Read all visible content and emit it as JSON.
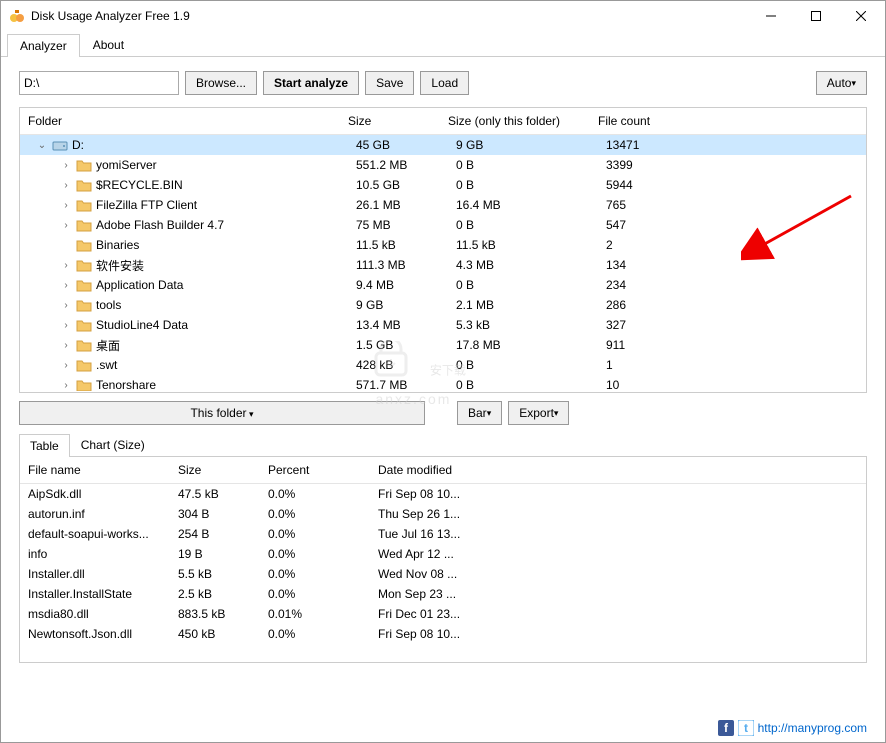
{
  "window": {
    "title": "Disk Usage Analyzer Free 1.9"
  },
  "tabs": {
    "analyzer": "Analyzer",
    "about": "About"
  },
  "toolbar": {
    "path": "D:\\",
    "browse": "Browse...",
    "start": "Start analyze",
    "save": "Save",
    "load": "Load",
    "auto": "Auto"
  },
  "tree_columns": {
    "folder": "Folder",
    "size": "Size",
    "size_only": "Size (only this folder)",
    "file_count": "File count"
  },
  "tree": [
    {
      "indent": 0,
      "expand": "⌄",
      "icon": "drive",
      "name": "D:",
      "size": "45 GB",
      "size_only": "9 GB",
      "count": "13471",
      "selected": true
    },
    {
      "indent": 1,
      "expand": "›",
      "icon": "folder",
      "name": "yomiServer",
      "size": "551.2 MB",
      "size_only": "0 B",
      "count": "3399"
    },
    {
      "indent": 1,
      "expand": "›",
      "icon": "folder",
      "name": "$RECYCLE.BIN",
      "size": "10.5 GB",
      "size_only": "0 B",
      "count": "5944"
    },
    {
      "indent": 1,
      "expand": "›",
      "icon": "folder",
      "name": "FileZilla FTP Client",
      "size": "26.1 MB",
      "size_only": "16.4 MB",
      "count": "765"
    },
    {
      "indent": 1,
      "expand": "›",
      "icon": "folder",
      "name": "Adobe Flash Builder 4.7",
      "size": "75 MB",
      "size_only": "0 B",
      "count": "547"
    },
    {
      "indent": 1,
      "expand": "",
      "icon": "folder",
      "name": "Binaries",
      "size": "11.5 kB",
      "size_only": "11.5 kB",
      "count": "2"
    },
    {
      "indent": 1,
      "expand": "›",
      "icon": "folder",
      "name": "软件安装",
      "size": "111.3 MB",
      "size_only": "4.3 MB",
      "count": "134"
    },
    {
      "indent": 1,
      "expand": "›",
      "icon": "folder",
      "name": "Application Data",
      "size": "9.4 MB",
      "size_only": "0 B",
      "count": "234"
    },
    {
      "indent": 1,
      "expand": "›",
      "icon": "folder",
      "name": "tools",
      "size": "9 GB",
      "size_only": "2.1 MB",
      "count": "286"
    },
    {
      "indent": 1,
      "expand": "›",
      "icon": "folder",
      "name": "StudioLine4 Data",
      "size": "13.4 MB",
      "size_only": "5.3 kB",
      "count": "327"
    },
    {
      "indent": 1,
      "expand": "›",
      "icon": "folder",
      "name": "桌面",
      "size": "1.5 GB",
      "size_only": "17.8 MB",
      "count": "911"
    },
    {
      "indent": 1,
      "expand": "›",
      "icon": "folder",
      "name": ".swt",
      "size": "428 kB",
      "size_only": "0 B",
      "count": "1"
    },
    {
      "indent": 1,
      "expand": "›",
      "icon": "folder",
      "name": "Tenorshare",
      "size": "571.7 MB",
      "size_only": "0 B",
      "count": "10"
    }
  ],
  "mid": {
    "this_folder": "This folder",
    "bar": "Bar",
    "export": "Export"
  },
  "bottom_tabs": {
    "table": "Table",
    "chart": "Chart (Size)"
  },
  "file_columns": {
    "name": "File name",
    "size": "Size",
    "percent": "Percent",
    "date": "Date modified"
  },
  "files": [
    {
      "name": "AipSdk.dll",
      "size": "47.5 kB",
      "percent": "0.0%",
      "date": "Fri Sep 08 10..."
    },
    {
      "name": "autorun.inf",
      "size": "304 B",
      "percent": "0.0%",
      "date": "Thu Sep 26 1..."
    },
    {
      "name": "default-soapui-works...",
      "size": "254 B",
      "percent": "0.0%",
      "date": "Tue Jul 16 13..."
    },
    {
      "name": "info",
      "size": "19 B",
      "percent": "0.0%",
      "date": "Wed Apr 12 ..."
    },
    {
      "name": "Installer.dll",
      "size": "5.5 kB",
      "percent": "0.0%",
      "date": "Wed Nov 08 ..."
    },
    {
      "name": "Installer.InstallState",
      "size": "2.5 kB",
      "percent": "0.0%",
      "date": "Mon Sep 23 ..."
    },
    {
      "name": "msdia80.dll",
      "size": "883.5 kB",
      "percent": "0.01%",
      "date": "Fri Dec 01 23..."
    },
    {
      "name": "Newtonsoft.Json.dll",
      "size": "450 kB",
      "percent": "0.0%",
      "date": "Fri Sep 08 10..."
    }
  ],
  "footer": {
    "url": "http://manyprog.com"
  },
  "watermark": {
    "main": "安下载",
    "sub": "anxz.com"
  }
}
